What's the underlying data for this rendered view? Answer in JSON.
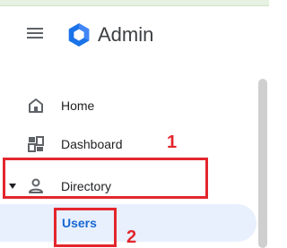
{
  "header": {
    "app_title": "Admin"
  },
  "nav": {
    "home": "Home",
    "dashboard": "Dashboard",
    "directory": "Directory",
    "users": "Users"
  },
  "annotations": {
    "first": "1",
    "second": "2"
  },
  "colors": {
    "accent": "#1967d2",
    "selected_bg": "#e8f0fe",
    "annotation_red": "#e3262d",
    "icon_gray": "#5f6368",
    "logo_blue": "#4285f4"
  },
  "icons": {
    "menu": "hamburger-menu-icon",
    "logo": "hexagon-logo-icon",
    "home": "home-icon",
    "dashboard": "dashboard-icon",
    "directory": "person-icon",
    "expand": "caret-down-icon"
  }
}
